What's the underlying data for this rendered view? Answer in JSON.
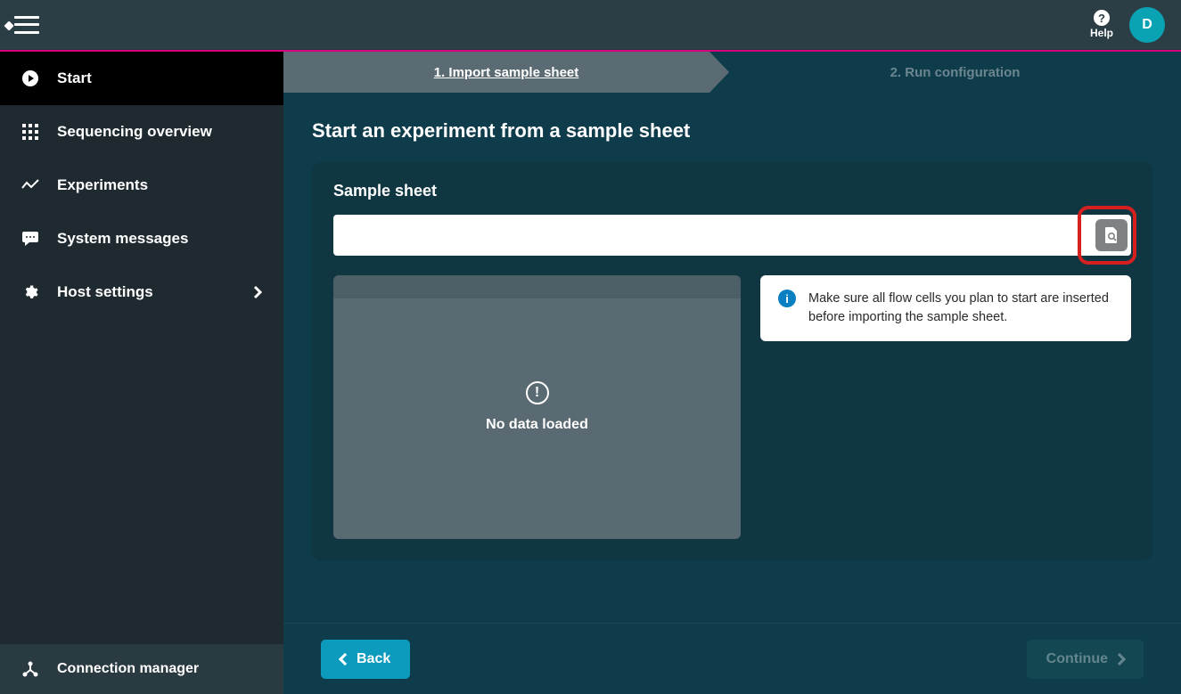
{
  "header": {
    "help_label": "Help",
    "avatar_initial": "D"
  },
  "sidebar": {
    "items": [
      {
        "label": "Start"
      },
      {
        "label": "Sequencing overview"
      },
      {
        "label": "Experiments"
      },
      {
        "label": "System messages"
      },
      {
        "label": "Host settings"
      }
    ],
    "footer_label": "Connection manager"
  },
  "stepper": {
    "step1": "1. Import sample sheet",
    "step2": "2. Run configuration"
  },
  "page": {
    "title": "Start an experiment from a sample sheet",
    "card_title": "Sample sheet",
    "path_value": "",
    "no_data_text": "No data loaded",
    "info_message": "Make sure all flow cells you plan to start are inserted before importing the sample sheet."
  },
  "footer": {
    "back_label": "Back",
    "continue_label": "Continue"
  }
}
